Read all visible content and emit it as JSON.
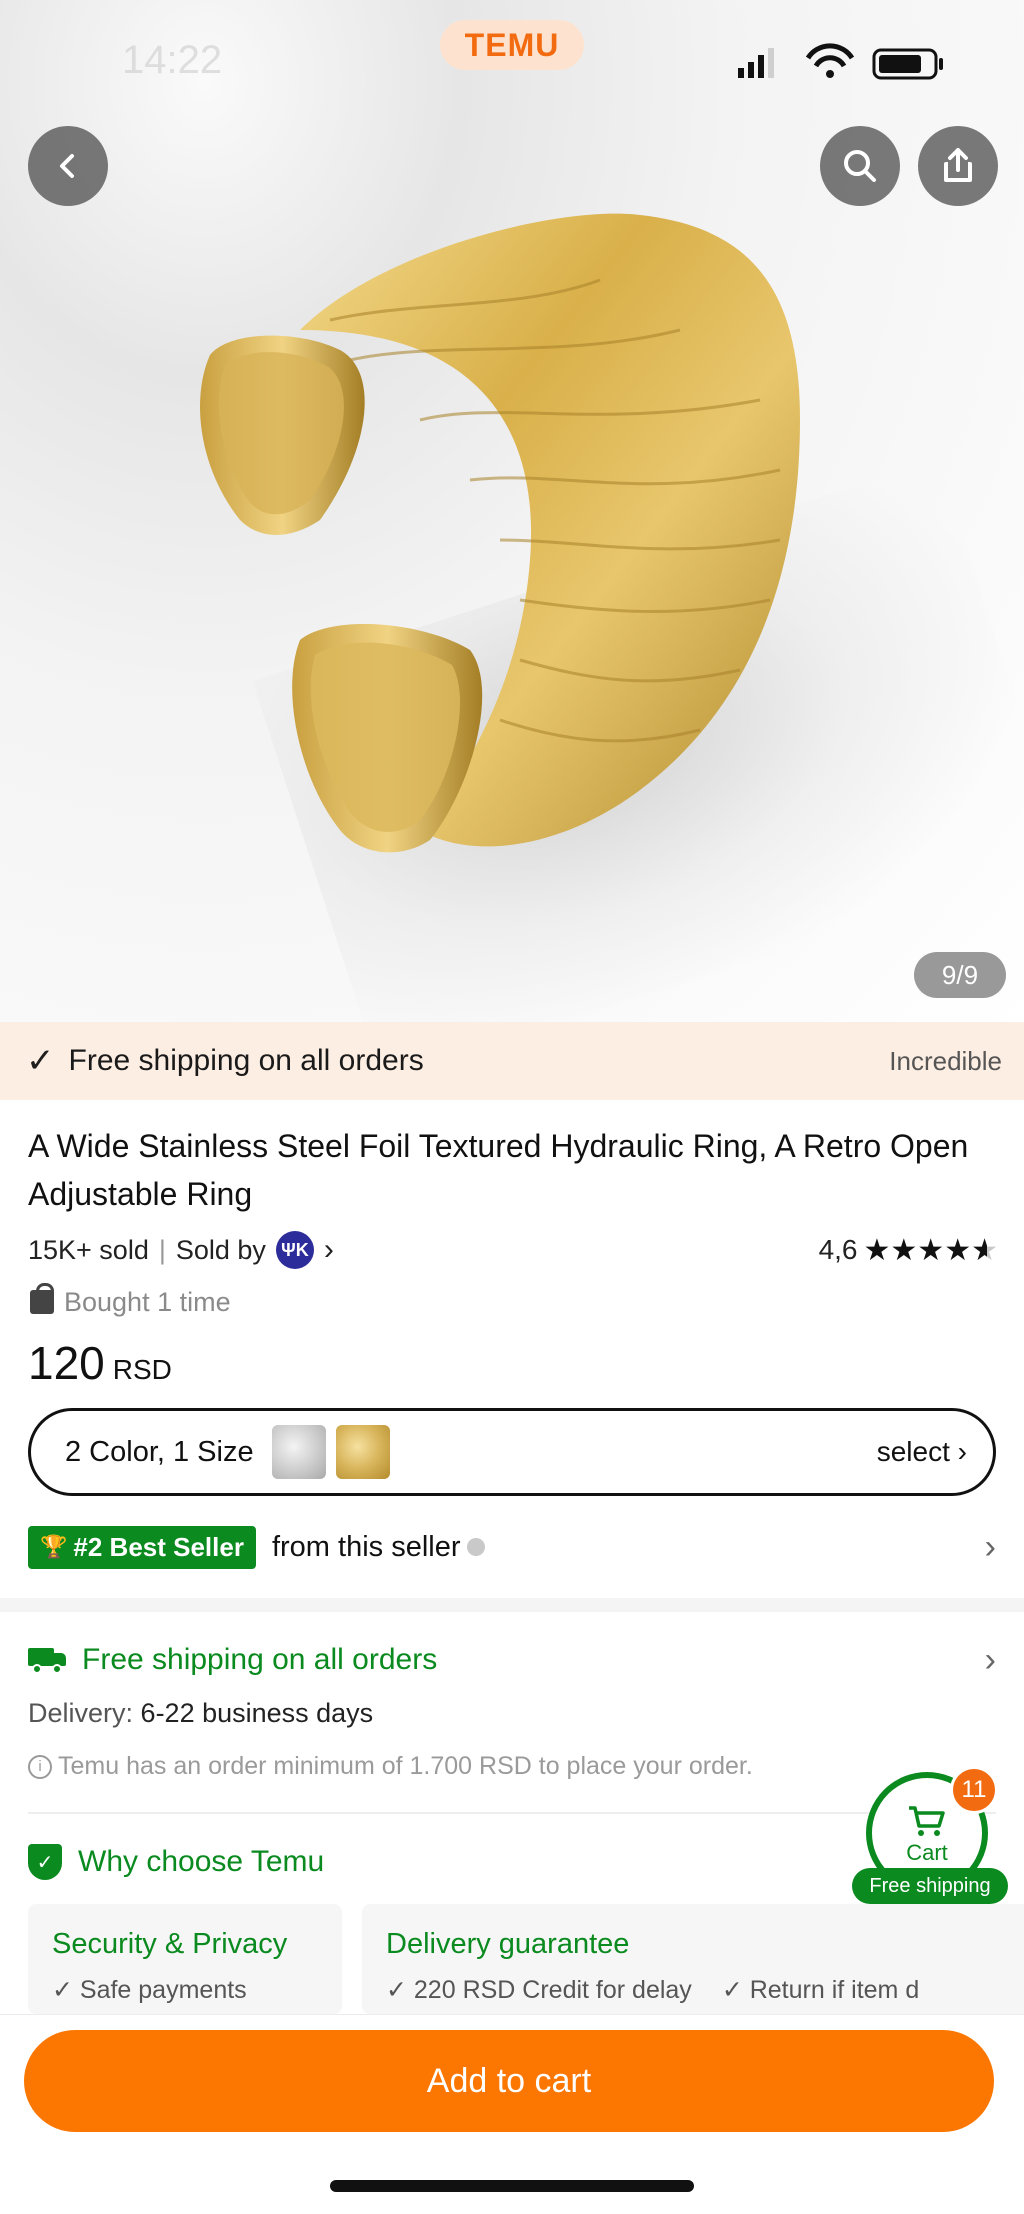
{
  "status_bar": {
    "time": "14:22",
    "brand": "TEMU"
  },
  "gallery": {
    "counter": "9/9"
  },
  "shipping_banner": {
    "text": "Free shipping on all orders",
    "tag": "Incredible"
  },
  "product": {
    "title": "A Wide Stainless Steel Foil Textured Hydraulic Ring, A Retro Open Adjustable Ring",
    "sold": "15K+ sold",
    "sold_by": "Sold by",
    "seller_initials": "ΨΚ",
    "rating": "4,6",
    "rating_value": 4.6,
    "bought": "Bought 1 time",
    "price": "120",
    "currency": "RSD"
  },
  "options": {
    "label": "2 Color, 1 Size",
    "select": "select"
  },
  "bestseller": {
    "badge": "#2 Best Seller",
    "text": "from this seller"
  },
  "shipping": {
    "title": "Free shipping on all orders",
    "delivery_label": "Delivery:",
    "delivery_value": "6-22 business days",
    "order_minimum": "Temu has an order minimum of 1.700 RSD to place your order."
  },
  "why": {
    "title": "Why choose Temu",
    "cards": [
      {
        "head": "Security & Privacy",
        "items": [
          "Safe payments"
        ]
      },
      {
        "head": "Delivery guarantee",
        "items": [
          "220 RSD Credit for delay",
          "Return if item d"
        ]
      }
    ]
  },
  "cart": {
    "count": "11",
    "label": "Cart",
    "free_shipping": "Free shipping"
  },
  "bottom": {
    "add_to_cart": "Add to cart"
  },
  "colors": {
    "brand_orange": "#fb7701",
    "green": "#0a8a1f",
    "banner_bg": "#fdeee3"
  },
  "icons": [
    "back-icon",
    "search-icon",
    "share-icon",
    "check-icon",
    "truck-icon",
    "shield-icon",
    "cart-icon",
    "info-icon",
    "chevron-right-icon",
    "trophy-icon",
    "bag-icon"
  ]
}
